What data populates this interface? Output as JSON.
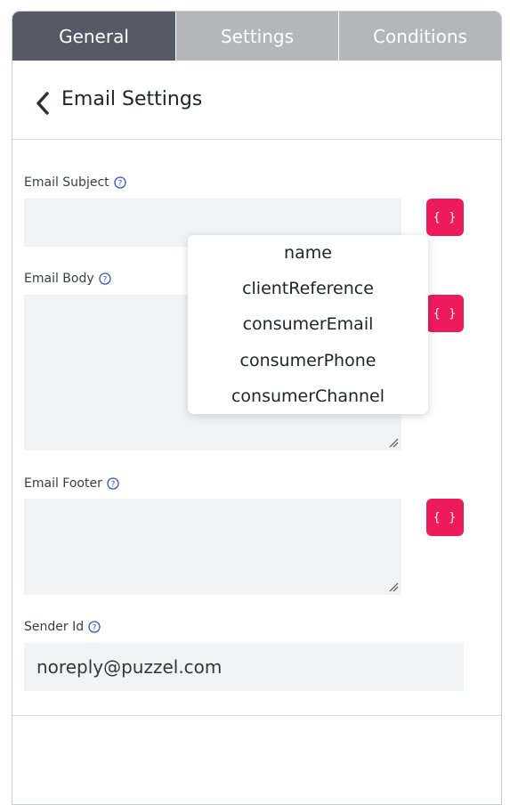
{
  "tabs": [
    {
      "label": "General",
      "active": true
    },
    {
      "label": "Settings",
      "active": false
    },
    {
      "label": "Conditions",
      "active": false
    }
  ],
  "header": {
    "title": "Email Settings",
    "back_icon": "chevron-left-icon"
  },
  "fields": {
    "subject": {
      "label": "Email Subject",
      "value": ""
    },
    "body": {
      "label": "Email Body",
      "value": ""
    },
    "footer": {
      "label": "Email Footer",
      "value": ""
    },
    "sender": {
      "label": "Sender Id",
      "value": "noreply@puzzel.com"
    }
  },
  "variable_button": {
    "label": "{ }",
    "icon": "curly-braces-icon"
  },
  "variables_menu": {
    "items": [
      "name",
      "clientReference",
      "consumerEmail",
      "consumerPhone",
      "consumerChannel"
    ]
  },
  "colors": {
    "active_tab": "#545a66",
    "inactive_tab": "#b4b6ba",
    "accent": "#ee1b5c",
    "help_icon": "#2f56c8",
    "field_bg": "#f2f3f5"
  }
}
